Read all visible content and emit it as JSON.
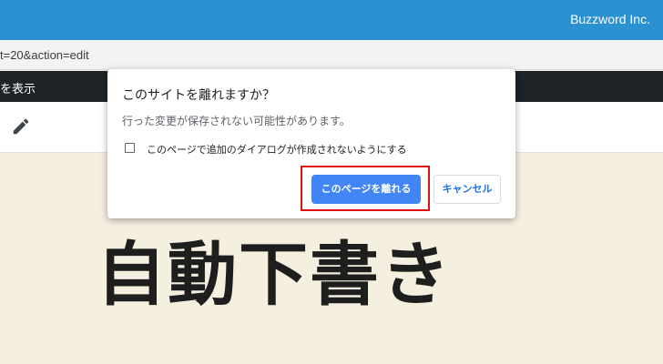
{
  "header": {
    "brand": "Buzzword Inc.",
    "brand_color": "#2b91d0"
  },
  "address_bar": {
    "url_fragment": "t=20&action=edit"
  },
  "wp_toolbar": {
    "label_fragment": "を表示"
  },
  "editor": {
    "edit_icon": "pencil-icon",
    "title_text": "自動下書き"
  },
  "dialog": {
    "title": "このサイトを離れますか？",
    "message": "行った変更が保存されない可能性があります。",
    "checkbox_label": "このページで追加のダイアログが作成されないようにする",
    "checkbox_checked": false,
    "leave_button": "このページを離れる",
    "cancel_button": "キャンセル",
    "primary_color": "#4285f4"
  },
  "annotation": {
    "highlight_color": "#e01010"
  }
}
